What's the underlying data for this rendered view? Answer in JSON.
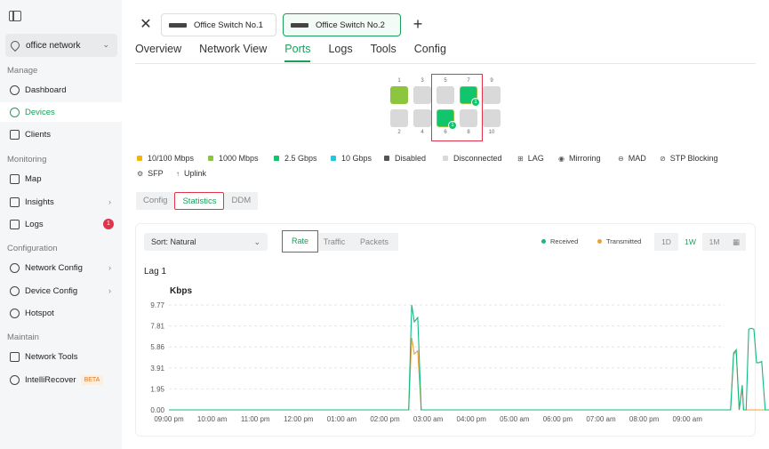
{
  "sidebar": {
    "site": "office network",
    "sections": {
      "manage": "Manage",
      "monitoring": "Monitoring",
      "configuration": "Configuration",
      "maintain": "Maintain"
    },
    "items": {
      "dashboard": "Dashboard",
      "devices": "Devices",
      "clients": "Clients",
      "map": "Map",
      "insights": "Insights",
      "logs": "Logs",
      "logs_badge": "1",
      "network_config": "Network Config",
      "device_config": "Device Config",
      "hotspot": "Hotspot",
      "network_tools": "Network Tools",
      "intellirecover": "IntelliRecover",
      "beta": "BETA"
    }
  },
  "device_tabs": [
    "Office Switch No.1",
    "Office Switch No.2"
  ],
  "tabs": [
    "Overview",
    "Network View",
    "Ports",
    "Logs",
    "Tools",
    "Config"
  ],
  "ports": {
    "top": [
      "1",
      "3",
      "5",
      "7",
      "9"
    ],
    "bottom": [
      "2",
      "4",
      "6",
      "8",
      "10"
    ],
    "lag_label": "1"
  },
  "legend": [
    "10/100 Mbps",
    "1000 Mbps",
    "2.5 Gbps",
    "10 Gbps",
    "Disabled",
    "Disconnected",
    "LAG",
    "Mirroring",
    "MAD",
    "STP Blocking",
    "SFP",
    "Uplink"
  ],
  "colors": {
    "c100": "#f2b705",
    "c1000": "#8cc63f",
    "c25": "#12c46b",
    "c10g": "#1fc8dd",
    "disabled": "#555555",
    "disconnected": "#d9d9d9",
    "received": "#12b886",
    "transmitted": "#f0a030"
  },
  "subtabs": [
    "Config",
    "Statistics",
    "DDM"
  ],
  "stats": {
    "sort": "Sort: Natural",
    "modes": [
      "Rate",
      "Traffic",
      "Packets"
    ],
    "received": "Received",
    "transmitted": "Transmitted",
    "ranges": [
      "1D",
      "1W",
      "1M"
    ]
  },
  "chart_title": "Lag 1",
  "chart_unit": "Kbps",
  "chart_data": {
    "type": "line",
    "ylabel": "Kbps",
    "ylim": [
      0,
      9.77
    ],
    "yticks": [
      "9.77",
      "7.81",
      "5.86",
      "3.91",
      "1.95",
      "0.00"
    ],
    "xticks": [
      "09:00 pm",
      "10:00 am",
      "11:00 pm",
      "12:00 pm",
      "01:00 am",
      "02:00 pm",
      "03:00 am",
      "04:00 pm",
      "05:00 am",
      "06:00 pm",
      "07:00 am",
      "08:00 pm",
      "09:00 am"
    ],
    "series": [
      {
        "name": "Received",
        "x": [
          0,
          5.55,
          5.62,
          5.68,
          5.76,
          5.84,
          12,
          13.0,
          13.07,
          13.13,
          13.2,
          13.27,
          13.3,
          13.36,
          13.42,
          13.48,
          13.54,
          13.6,
          13.66,
          13.72,
          13.8,
          14.3,
          16.7
        ],
        "values": [
          0,
          0,
          9.77,
          8.2,
          8.6,
          0,
          0,
          0,
          5.3,
          5.6,
          0,
          2.3,
          0,
          0,
          7.5,
          7.6,
          7.5,
          4.4,
          4.4,
          4.5,
          0,
          0,
          0
        ]
      },
      {
        "name": "Transmitted",
        "x": [
          0,
          5.55,
          5.62,
          5.68,
          5.76,
          5.84,
          12,
          13.0,
          13.07,
          13.13,
          13.2,
          13.27,
          13.3,
          13.36,
          13.42,
          16.7
        ],
        "values": [
          0,
          0,
          6.7,
          5.2,
          5.5,
          0,
          0,
          0,
          5.2,
          5.4,
          0,
          2.1,
          0,
          0,
          0,
          0
        ]
      }
    ]
  }
}
